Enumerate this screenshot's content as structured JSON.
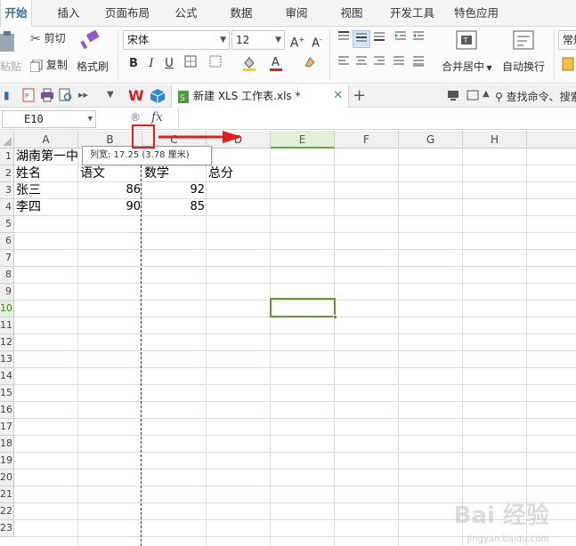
{
  "menu": {
    "tabs": [
      "开始",
      "插入",
      "页面布局",
      "公式",
      "数据",
      "审阅",
      "视图",
      "开发工具",
      "特色应用"
    ],
    "active": 0
  },
  "ribbon": {
    "paste": "粘贴",
    "cut": "剪切",
    "copy": "复制",
    "format_painter": "格式刷",
    "font_name": "宋体",
    "font_size": "12",
    "bold": "B",
    "italic": "I",
    "underline": "U",
    "merge_center": "合并居中",
    "wrap_text": "自动换行",
    "number_format": "常规"
  },
  "quickbar": {
    "doc_tab": "新建 XLS 工作表.xls *",
    "search": "查找命令、搜索"
  },
  "formula_bar": {
    "name_box": "E10",
    "fx": "fx"
  },
  "columns": [
    "A",
    "B",
    "C",
    "D",
    "E",
    "F",
    "G",
    "H"
  ],
  "active_column": "E",
  "rows": [
    "1",
    "2",
    "3",
    "4",
    "5",
    "6",
    "7",
    "8",
    "9",
    "10",
    "11",
    "12",
    "13",
    "14",
    "15",
    "16",
    "17",
    "18",
    "19",
    "20",
    "21",
    "22",
    "23"
  ],
  "active_row": "10",
  "cells": {
    "a1": "湖南第一中",
    "a2": "姓名",
    "b2": "语文",
    "c2": "数学",
    "d2": "总分",
    "a3": "张三",
    "b3": "86",
    "c3": "92",
    "a4": "李四",
    "b4": "90",
    "c4": "85"
  },
  "tooltip": "列宽: 17.25 (3.78 厘米)",
  "watermark": "Bai 经验",
  "watermark_url": "jingyan.baidu.com",
  "colors": {
    "accent": "#2f6db5",
    "selection": "#5b9b2f",
    "annotation": "#e02020"
  }
}
